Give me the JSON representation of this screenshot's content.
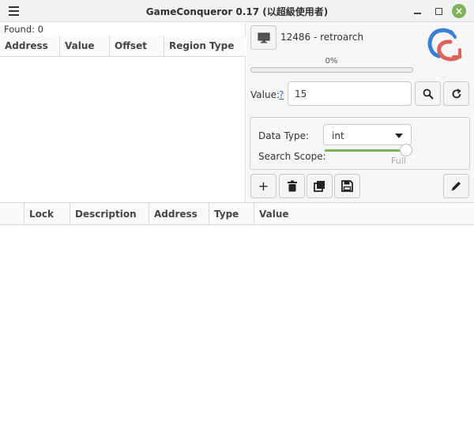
{
  "window": {
    "title": "GameConqueror 0.17 (以超級使用者)",
    "close_glyph": "×"
  },
  "results": {
    "found_label": "Found: 0",
    "columns": [
      "Address",
      "Value",
      "Offset",
      "Region Type"
    ]
  },
  "process": {
    "label": "12486 - retroarch",
    "icon": "monitor-icon"
  },
  "progress": {
    "percent_text": "0%",
    "fraction": 0
  },
  "search": {
    "value_label": "Value:",
    "help_link": "?",
    "value": "15",
    "search_icon": "search-icon",
    "reset_icon": "refresh-icon"
  },
  "options": {
    "data_type_label": "Data Type:",
    "data_type": "int",
    "scope_label": "Search Scope:",
    "scope_value": "Full"
  },
  "toolbar": {
    "add_glyph": "+",
    "icons": [
      "plus-icon",
      "trash-icon",
      "copy-icon",
      "save-icon",
      "pencil-icon"
    ]
  },
  "cheats": {
    "columns": [
      "",
      "Lock",
      "Description",
      "Address",
      "Type",
      "Value"
    ]
  },
  "colors": {
    "accent": "#7fb45b",
    "logo_blue": "#3a7fd6",
    "logo_red": "#e0605a"
  }
}
